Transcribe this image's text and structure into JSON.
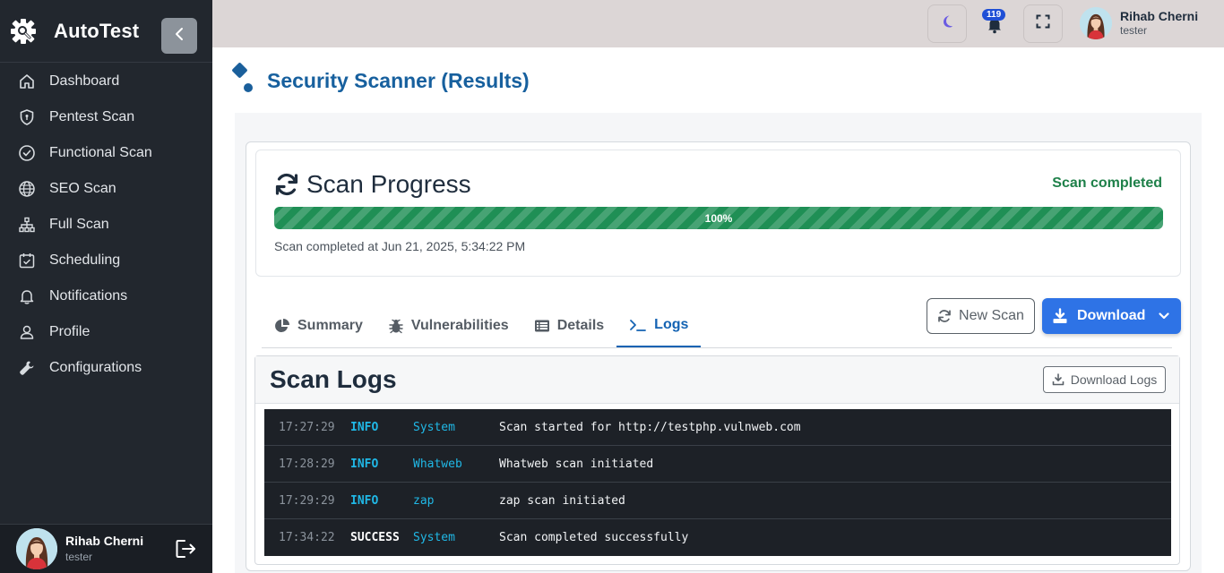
{
  "brand": {
    "name": "AutoTest"
  },
  "sidebar": {
    "items": [
      {
        "label": "Dashboard",
        "icon": "home-icon"
      },
      {
        "label": "Pentest Scan",
        "icon": "shield-icon"
      },
      {
        "label": "Functional Scan",
        "icon": "check-circle-icon"
      },
      {
        "label": "SEO Scan",
        "icon": "globe-icon"
      },
      {
        "label": "Full Scan",
        "icon": "sitemap-icon"
      },
      {
        "label": "Scheduling",
        "icon": "calendar-icon"
      },
      {
        "label": "Notifications",
        "icon": "bell-icon"
      },
      {
        "label": "Profile",
        "icon": "user-icon"
      },
      {
        "label": "Configurations",
        "icon": "wrench-icon"
      }
    ],
    "user": {
      "name": "Rihab Cherni",
      "role": "tester"
    }
  },
  "topbar": {
    "notification_count": "119",
    "user": {
      "name": "Rihab Cherni",
      "role": "tester"
    }
  },
  "page": {
    "title": "Security Scanner (Results)"
  },
  "progress": {
    "title": "Scan Progress",
    "status": "Scan completed",
    "percent_label": "100%",
    "percent": 100,
    "completed_at": "Scan completed at Jun 21, 2025, 5:34:22 PM"
  },
  "tabs": [
    {
      "label": "Summary",
      "icon": "pie-chart-icon",
      "active": false
    },
    {
      "label": "Vulnerabilities",
      "icon": "bug-icon",
      "active": false
    },
    {
      "label": "Details",
      "icon": "list-icon",
      "active": false
    },
    {
      "label": "Logs",
      "icon": "terminal-icon",
      "active": true
    }
  ],
  "actions": {
    "new_scan": "New Scan",
    "download": "Download"
  },
  "logs": {
    "title": "Scan Logs",
    "download_label": "Download Logs",
    "entries": [
      {
        "time": "17:27:29",
        "level": "INFO",
        "source": "System",
        "message": "Scan started for http://testphp.vulnweb.com"
      },
      {
        "time": "17:28:29",
        "level": "INFO",
        "source": "Whatweb",
        "message": "Whatweb scan initiated"
      },
      {
        "time": "17:29:29",
        "level": "INFO",
        "source": "zap",
        "message": "zap scan initiated"
      },
      {
        "time": "17:34:22",
        "level": "SUCCESS",
        "source": "System",
        "message": "Scan completed successfully"
      }
    ]
  },
  "colors": {
    "sidebar_bg": "#22272e",
    "topbar_bg": "#dcd6d6",
    "title_blue": "#17609e",
    "success_green": "#1e8049",
    "progress_green": "#1f8f55",
    "primary_blue": "#2e73e6",
    "console_bg": "#1d2127",
    "log_cyan": "#20b8e6"
  }
}
